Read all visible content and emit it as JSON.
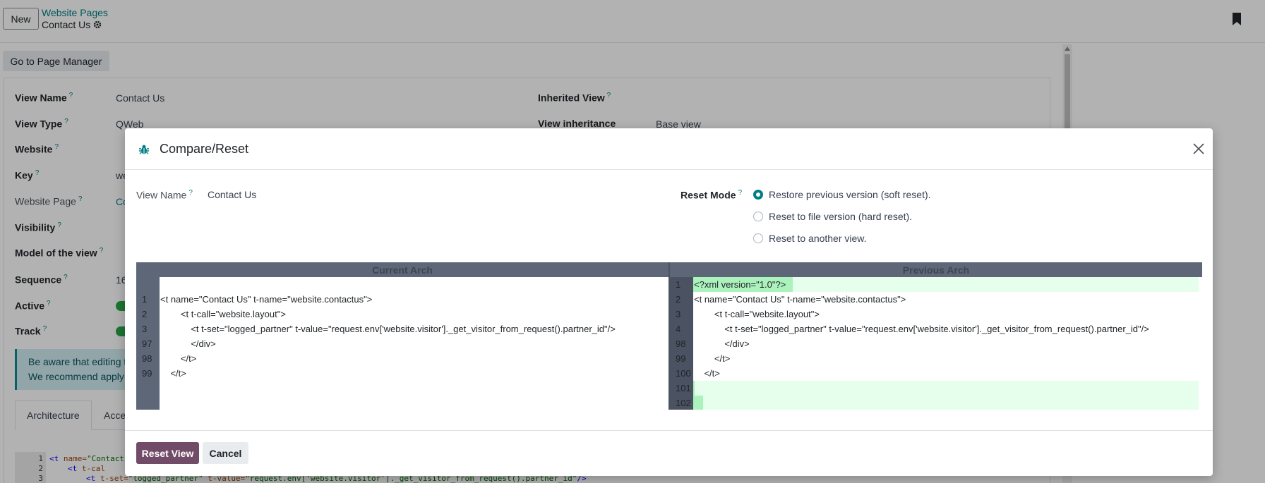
{
  "header": {
    "new_button": "New",
    "breadcrumb_parent": "Website Pages",
    "breadcrumb_current": "Contact Us"
  },
  "form": {
    "page_manager_button": "Go to Page Manager",
    "fields": {
      "view_name": {
        "label": "View Name",
        "value": "Contact Us"
      },
      "view_type": {
        "label": "View Type",
        "value": "QWeb"
      },
      "website": {
        "label": "Website"
      },
      "key": {
        "label": "Key",
        "value": "we"
      },
      "website_page": {
        "label": "Website Page",
        "value": "Co"
      },
      "visibility": {
        "label": "Visibility"
      },
      "model": {
        "label": "Model of the view"
      },
      "sequence": {
        "label": "Sequence",
        "value": "16"
      },
      "active": {
        "label": "Active",
        "value": true
      },
      "track": {
        "label": "Track",
        "value": true
      },
      "inherited_view": {
        "label": "Inherited View"
      },
      "view_inheritance": {
        "label": "View inheritance",
        "value": "Base view"
      }
    },
    "alert_line1": "Be aware that editing t",
    "alert_line2": "We recommend apply",
    "tabs": [
      "Architecture",
      "Acce"
    ],
    "code_gutter": [
      "1",
      "2",
      "3"
    ],
    "code_lines": [
      "<t name=\"Contact",
      "    <t t-cal",
      "      <t t-set=\"logged_partner\" t-value=\"request.env['website.visitor']._get_visitor_from_request().partner_id\"/>"
    ],
    "code_line1_parts": [
      "<t",
      " name=",
      "\"Contact"
    ],
    "code_line2_parts": [
      "<t",
      " t-cal"
    ],
    "code_line3_parts": [
      "<t",
      " t-set=",
      "\"logged_partner\"",
      " t-value=",
      "\"request.env['website.visitor']._get_visitor_from_request().partner_id\"",
      "/>"
    ]
  },
  "modal": {
    "title": "Compare/Reset",
    "view_name_label": "View Name",
    "view_name_value": "Contact Us",
    "reset_mode_label": "Reset Mode",
    "reset_options": [
      {
        "label": "Restore previous version (soft reset).",
        "selected": true
      },
      {
        "label": "Reset to file version (hard reset).",
        "selected": false
      },
      {
        "label": "Reset to another view.",
        "selected": false
      }
    ],
    "current_arch": {
      "header": "Current Arch",
      "line_numbers": [
        "",
        "1",
        "2",
        "3",
        "97",
        "98",
        "99"
      ],
      "lines": [
        "",
        "<t name=\"Contact Us\" t-name=\"website.contactus\">",
        "        <t t-call=\"website.layout\">",
        "            <t t-set=\"logged_partner\" t-value=\"request.env['website.visitor']._get_visitor_from_request().partner_id\"/>",
        "            </div>",
        "        </t>",
        "    </t>"
      ]
    },
    "previous_arch": {
      "header": "Previous Arch",
      "line_numbers": [
        "1",
        "2",
        "3",
        "4",
        "98",
        "99",
        "100",
        "101",
        "102"
      ],
      "lines": [
        "<?xml version=\"1.0\"?>",
        "<t name=\"Contact Us\" t-name=\"website.contactus\">",
        "        <t t-call=\"website.layout\">",
        "            <t t-set=\"logged_partner\" t-value=\"request.env['website.visitor']._get_visitor_from_request().partner_id\"/>",
        "            </div>",
        "        </t>",
        "    </t>",
        "",
        ""
      ]
    },
    "reset_button": "Reset View",
    "cancel_button": "Cancel"
  },
  "colors": {
    "brand": "#714b67",
    "accent": "#017e84",
    "diff_added": "#e6ffed",
    "diff_added_strong": "#acf2bd"
  }
}
